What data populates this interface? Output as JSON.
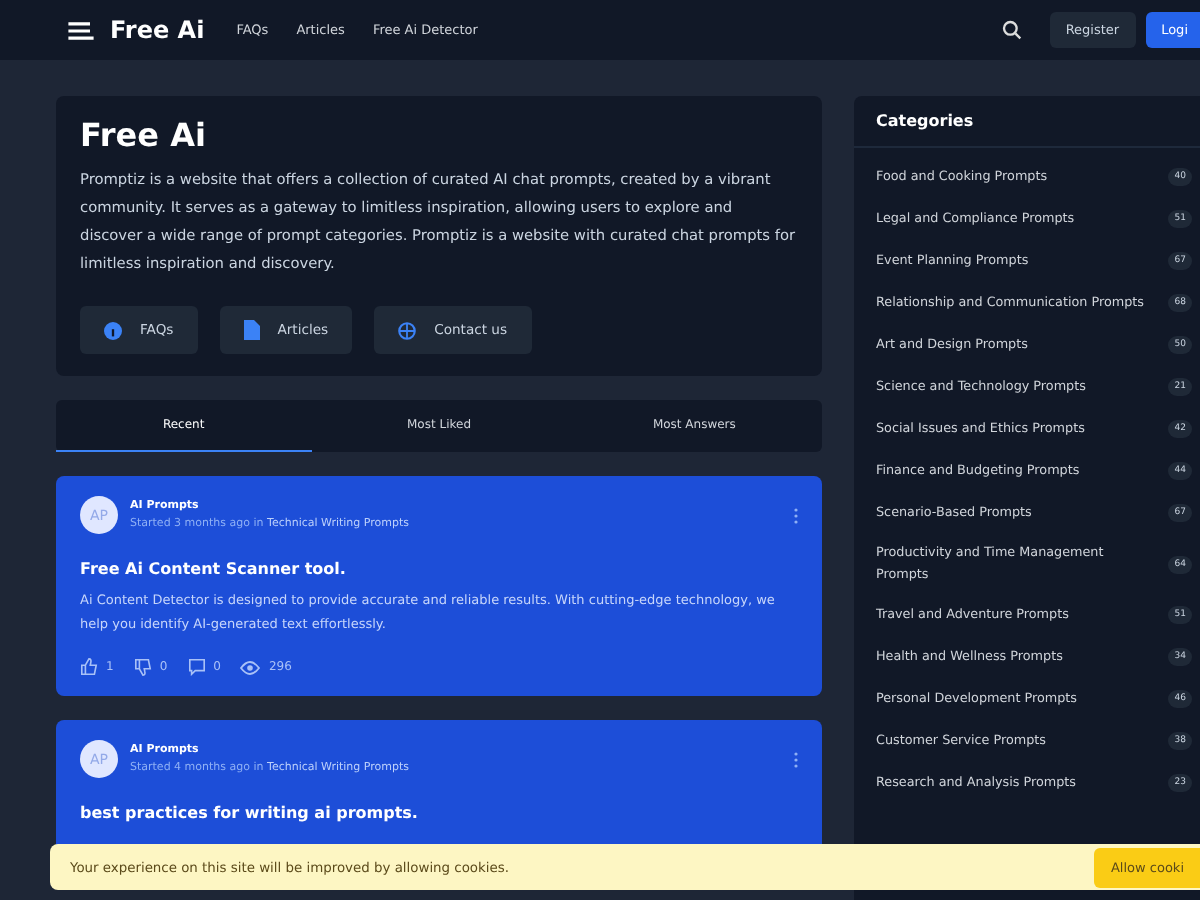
{
  "header": {
    "logo": "Free Ai",
    "nav": [
      "FAQs",
      "Articles",
      "Free Ai Detector"
    ],
    "register": "Register",
    "login": "Logi"
  },
  "hero": {
    "title": "Free Ai",
    "text": "Promptiz is a website that offers a collection of curated AI chat prompts, created by a vibrant community. It serves as a gateway to limitless inspiration, allowing users to explore and discover a wide range of prompt categories. Promptiz is a website with curated chat prompts for limitless inspiration and discovery.",
    "buttons": [
      {
        "label": "FAQs",
        "kind": "info"
      },
      {
        "label": "Articles",
        "kind": "doc"
      },
      {
        "label": "Contact us",
        "kind": "globe"
      }
    ]
  },
  "tabs": [
    {
      "label": "Recent",
      "selected": true
    },
    {
      "label": "Most Liked",
      "selected": false
    },
    {
      "label": "Most Answers",
      "selected": false
    }
  ],
  "posts": [
    {
      "avatar": "AP",
      "author": "AI Prompts",
      "meta": "Started 3 months ago in",
      "category": "Technical Writing Prompts",
      "title": "Free Ai Content Scanner tool.",
      "body": "Ai Content Detector is designed to provide accurate and reliable results. With cutting-edge technology, we help you identify AI-generated text effortlessly.",
      "likes": "1",
      "dislikes": "0",
      "comments": "0",
      "views": "296"
    },
    {
      "avatar": "AP",
      "author": "AI Prompts",
      "meta": "Started 4 months ago in",
      "category": "Technical Writing Prompts",
      "title": "best practices for writing ai prompts."
    }
  ],
  "sidebar": {
    "title": "Categories",
    "items": [
      {
        "label": "Food and Cooking Prompts",
        "count": "40"
      },
      {
        "label": "Legal and Compliance Prompts",
        "count": "51"
      },
      {
        "label": "Event Planning Prompts",
        "count": "67"
      },
      {
        "label": "Relationship and Communication Prompts",
        "count": "68"
      },
      {
        "label": "Art and Design Prompts",
        "count": "50"
      },
      {
        "label": "Science and Technology Prompts",
        "count": "21"
      },
      {
        "label": "Social Issues and Ethics Prompts",
        "count": "42"
      },
      {
        "label": "Finance and Budgeting Prompts",
        "count": "44"
      },
      {
        "label": "Scenario-Based Prompts",
        "count": "67"
      },
      {
        "label": "Productivity and Time Management Prompts",
        "count": "64"
      },
      {
        "label": "Travel and Adventure Prompts",
        "count": "51"
      },
      {
        "label": "Health and Wellness Prompts",
        "count": "34"
      },
      {
        "label": "Personal Development Prompts",
        "count": "46"
      },
      {
        "label": "Customer Service Prompts",
        "count": "38"
      },
      {
        "label": "Research and Analysis Prompts",
        "count": "23"
      }
    ]
  },
  "cookie": {
    "text": "Your experience on this site will be improved by allowing cookies.",
    "button": "Allow cooki"
  }
}
